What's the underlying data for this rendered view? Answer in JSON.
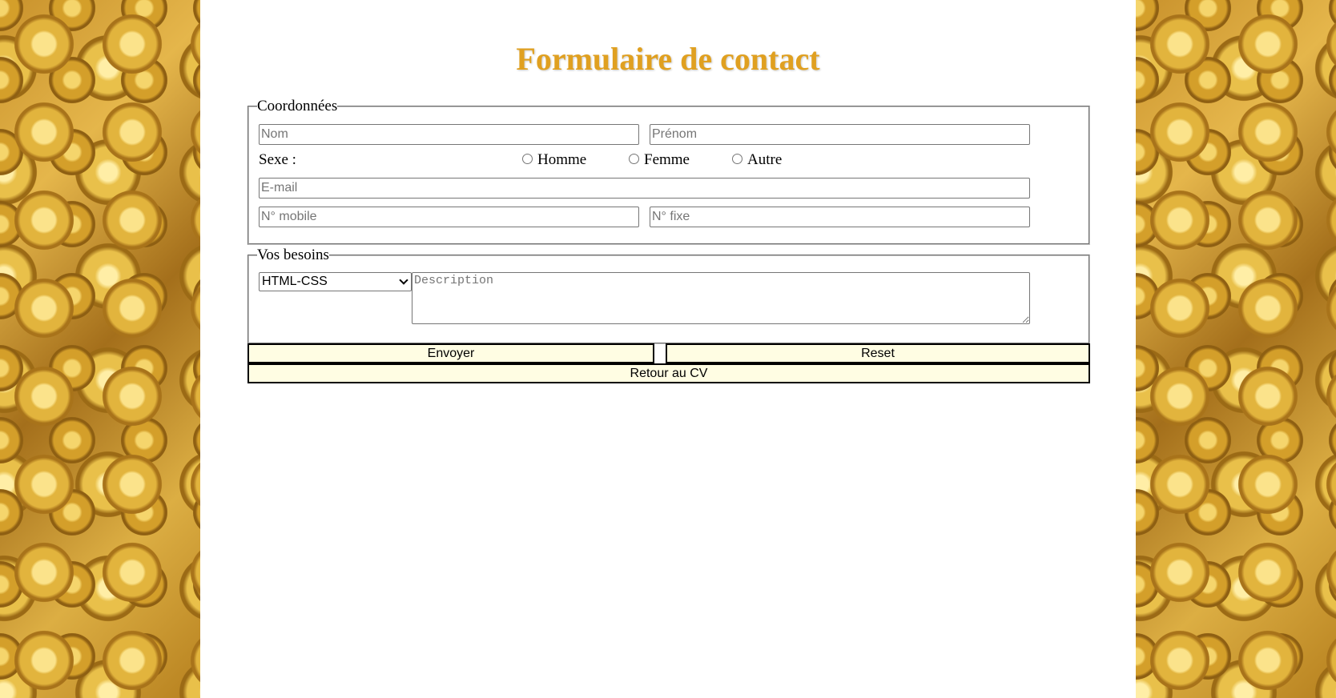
{
  "title": "Formulaire de contact",
  "coordonnees": {
    "legend": "Coordonnées",
    "nom_placeholder": "Nom",
    "prenom_placeholder": "Prénom",
    "sexe_label": "Sexe :",
    "sexe_options": [
      "Homme",
      "Femme",
      "Autre"
    ],
    "email_placeholder": "E-mail",
    "mobile_placeholder": "N° mobile",
    "fixe_placeholder": "N° fixe"
  },
  "besoins": {
    "legend": "Vos besoins",
    "selected_option": "HTML-CSS",
    "description_placeholder": "Description"
  },
  "buttons": {
    "envoyer": "Envoyer",
    "reset": "Reset",
    "retour": "Retour au CV"
  },
  "colors": {
    "title": "#e0a020",
    "button_bg": "#fffde3"
  }
}
